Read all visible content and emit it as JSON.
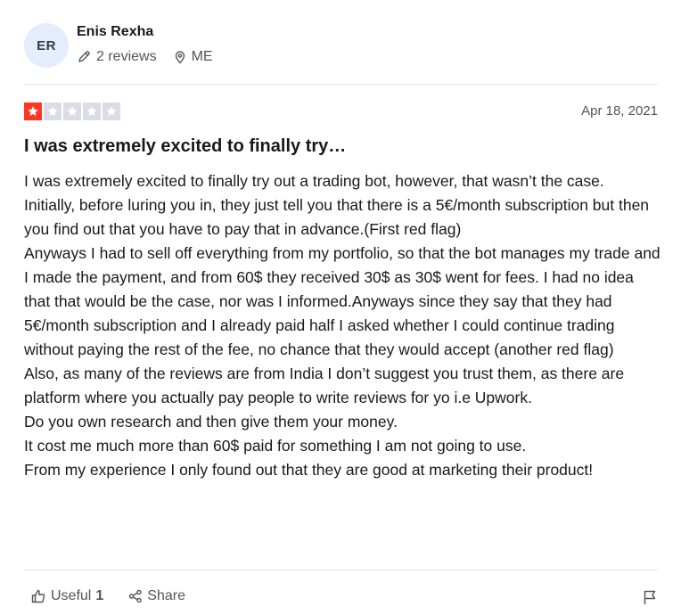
{
  "reviewer": {
    "initials": "ER",
    "name": "Enis Rexha",
    "reviews": "2 reviews",
    "location": "ME",
    "avatar_bg": "#e5ecfb"
  },
  "rating": {
    "stars": 1,
    "max": 5,
    "filled_color": "#ff3722",
    "empty_color": "#dcdce6"
  },
  "date": "Apr 18, 2021",
  "title": "I was extremely excited to finally try…",
  "body": [
    "I was extremely excited to finally try out a trading bot, however, that wasn’t the case.",
    "Initially, before luring you in, they just tell you that there is a 5€/month subscription but then you find out that you have to pay that in advance.(First red flag)",
    "Anyways I had to sell off everything from my portfolio, so that the bot manages my trade and I made the payment, and from 60$ they received 30$ as 30$ went for fees. I had no idea that that would be the case, nor was I informed.Anyways since they say that they had 5€/month subscription and I already paid half I asked whether I could continue trading without paying the rest of the fee, no chance that they would accept (another red flag)",
    "Also, as many of the reviews are from India I don’t suggest you trust them, as there are platform where you actually pay people to write reviews for yo i.e Upwork.",
    "Do you own research and then give them your money.",
    "It cost me much more than 60$ paid for something I am not going to use.",
    "From my experience I only found out that they are good at marketing their product!"
  ],
  "footer": {
    "useful_label": "Useful",
    "useful_count": "1",
    "share_label": "Share"
  },
  "icons": {
    "reviews": "pencil-icon",
    "location": "location-pin-icon",
    "useful": "thumbs-up-icon",
    "share": "share-icon",
    "flag": "flag-icon",
    "star": "star-icon"
  }
}
